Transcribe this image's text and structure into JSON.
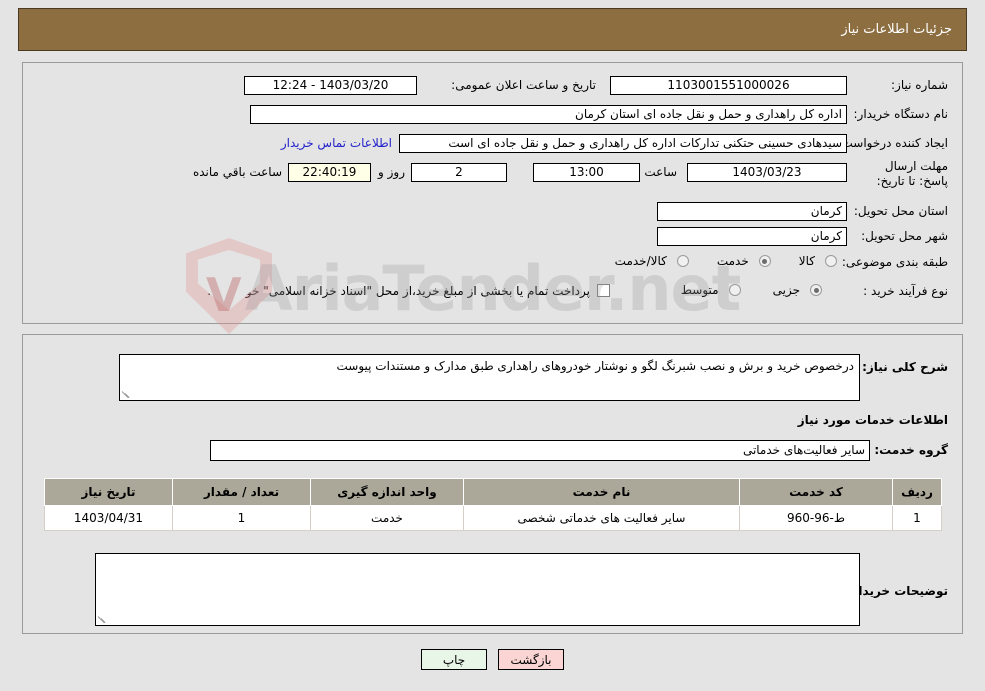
{
  "header": {
    "title": "جزئیات اطلاعات نیاز"
  },
  "watermark": {
    "text": "AriaTender.net",
    "mark": "V"
  },
  "info": {
    "need_number_label": "شماره نیاز:",
    "need_number_value": "1103001551000026",
    "announce_label": "تاریخ و ساعت اعلان عمومی:",
    "announce_value": "1403/03/20 - 12:24",
    "buyer_org_label": "نام دستگاه خریدار:",
    "buyer_org_value": "اداره کل راهداری و حمل و نقل جاده ای استان کرمان",
    "creator_label": "ایجاد کننده درخواست:",
    "creator_value": "سیدهادی حسینی حتکنی تدارکات اداره کل راهداری و حمل و نقل جاده ای است",
    "contact_link": "اطلاعات تماس خریدار",
    "deadline_label": "مهلت ارسال پاسخ: تا تاریخ:",
    "deadline_date": "1403/03/23",
    "hour_label": "ساعت",
    "hour_value": "13:00",
    "days_value": "2",
    "days_label": "روز و",
    "countdown_value": "22:40:19",
    "countdown_label": "ساعت باقي مانده",
    "province_label": "استان محل تحویل:",
    "province_value": "کرمان",
    "city_label": "شهر محل تحویل:",
    "city_value": "کرمان",
    "category_label": "طبقه بندی موضوعی:",
    "category_options": [
      {
        "label": "کالا",
        "selected": false
      },
      {
        "label": "خدمت",
        "selected": true
      },
      {
        "label": "کالا/خدمت",
        "selected": false
      }
    ],
    "process_label": "نوع فرآیند خرید :",
    "process_options": [
      {
        "label": "جزیی",
        "selected": true
      },
      {
        "label": "متوسط",
        "selected": false
      }
    ],
    "treasury_note": "پرداخت تمام یا بخشی از مبلغ خرید،از محل \"اسناد خزانه اسلامی\" خواهد بود."
  },
  "description": {
    "label": "شرح کلی نیاز:",
    "value": "درخصوص خرید و برش و نصب شبرنگ لگو و نوشتار خودروهای راهداری طبق مدارک و مستندات پیوست",
    "services_heading": "اطلاعات خدمات مورد نیاز",
    "service_group_label": "گروه خدمت:",
    "service_group_value": "سایر فعالیت‌های خدماتی"
  },
  "table": {
    "columns": [
      "ردیف",
      "کد خدمت",
      "نام خدمت",
      "واحد اندازه گیری",
      "تعداد / مقدار",
      "تاریخ نیاز"
    ],
    "rows": [
      {
        "index": "1",
        "code": "ط-96-960",
        "name": "سایر فعالیت های خدماتی شخصی",
        "unit": "خدمت",
        "qty": "1",
        "date": "1403/04/31"
      }
    ]
  },
  "buyer_notes": {
    "label": "توضیحات خریدار:",
    "value": ""
  },
  "footer": {
    "print_label": "چاپ",
    "back_label": "بازگشت"
  }
}
